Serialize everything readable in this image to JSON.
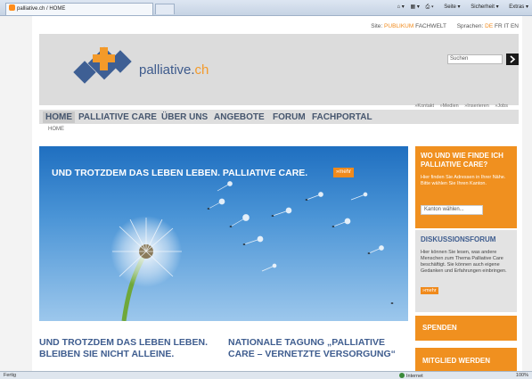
{
  "browser": {
    "tab_title": "palliative.ch / HOME",
    "tools": [
      "Seite",
      "Sicherheit",
      "Extras"
    ]
  },
  "utility": {
    "site_label": "Site:",
    "site_public": "PUBLIKUM",
    "site_fach": "FACHWELT",
    "lang_label": "Sprachen:",
    "lang_de": "DE",
    "lang_fr": "FR",
    "lang_it": "IT",
    "lang_en": "EN"
  },
  "logo": {
    "text": "palliative",
    "suffix": "ch"
  },
  "search": {
    "placeholder": "Suchen"
  },
  "meta_links": [
    "»Kontakt",
    "»Medien",
    "»Inserieren",
    "»Jobs"
  ],
  "nav": {
    "items": [
      "HOME",
      "PALLIATIVE CARE",
      "ÜBER UNS",
      "ANGEBOTE",
      "FORUM",
      "FACHPORTAL"
    ]
  },
  "breadcrumb": "HOME",
  "hero": {
    "headline": "UND TROTZDEM DAS LEBEN LEBEN. PALLIATIVE CARE.",
    "more": "»mehr"
  },
  "find_box": {
    "title": "WO UND WIE FINDE ICH PALLIATIVE CARE?",
    "text": "Hier finden Sie Adressen in Ihrer Nähe. Bitte wählen Sie Ihren Kanton.",
    "select_label": "Kanton wählen..."
  },
  "forum_box": {
    "title": "DISKUSSIONSFORUM",
    "text": "Hier können Sie lesen, was andere Menschen zum Thema Palliative Care beschäftigt. Sie können auch eigene Gedanken und Erfahrungen einbringen.",
    "more": "»mehr"
  },
  "spenden": "SPENDEN",
  "member": "MITGLIED WERDEN",
  "teasers": [
    {
      "title": "UND TROTZDEM DAS LEBEN LEBEN. BLEIBEN SIE NICHT ALLEINE."
    },
    {
      "title": "NATIONALE TAGUNG „PALLIATIVE CARE – VERNETZTE VERSORGUNG“"
    }
  ],
  "status": {
    "left": "Fertig",
    "zone": "Internet",
    "zoom": "100%"
  },
  "colors": {
    "accent": "#f08a1c",
    "brand_blue": "#3f5d8f",
    "header_grey": "#dcdcdc"
  }
}
